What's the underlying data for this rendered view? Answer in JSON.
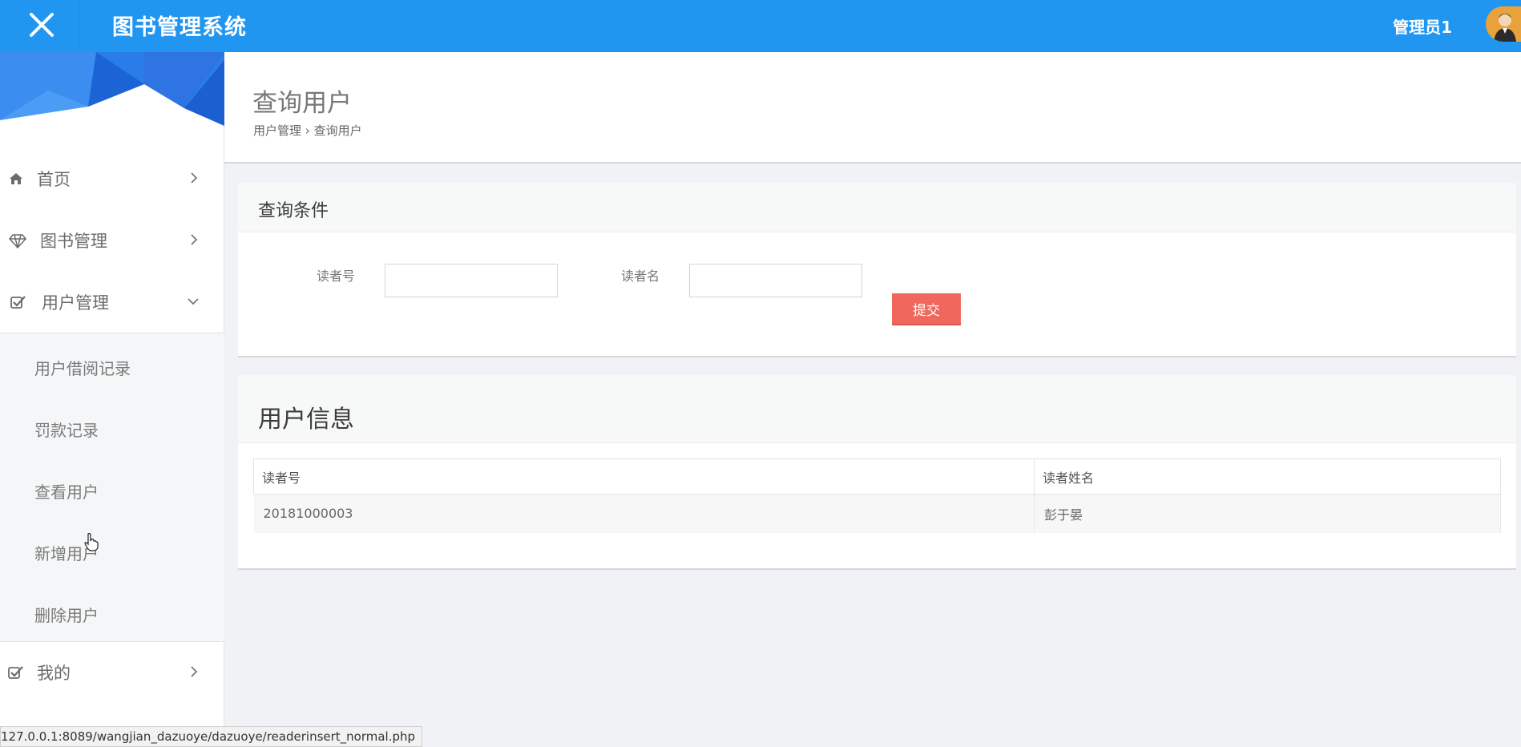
{
  "header": {
    "app_title": "图书管理系统",
    "user_name": "管理员1",
    "close_icon": "close-icon",
    "avatar_icon": "avatar"
  },
  "colors": {
    "topbar": "#2196f0",
    "submit_button": "#f0675b",
    "sidebar_banner": "#1f6fe0"
  },
  "sidebar": {
    "items": [
      {
        "label": "首页",
        "icon": "home-icon"
      },
      {
        "label": "图书管理",
        "icon": "diamond-icon"
      },
      {
        "label": "用户管理",
        "icon": "checkbox-icon",
        "expanded": true
      },
      {
        "label": "我的",
        "icon": "checkbox-icon"
      }
    ],
    "submenu": [
      {
        "label": "用户借阅记录"
      },
      {
        "label": "罚款记录"
      },
      {
        "label": "查看用户"
      },
      {
        "label": "新增用户"
      },
      {
        "label": "删除用户"
      }
    ]
  },
  "page": {
    "title": "查询用户",
    "breadcrumb": {
      "parent": "用户管理",
      "separator": "›",
      "current": "查询用户"
    }
  },
  "query_panel": {
    "title": "查询条件",
    "reader_id_label": "读者号",
    "reader_id_value": "",
    "reader_name_label": "读者名",
    "reader_name_value": "",
    "submit_label": "提交"
  },
  "results_panel": {
    "title": "用户信息",
    "columns": [
      "读者号",
      "读者姓名"
    ],
    "rows": [
      [
        "20181000003",
        "彭于晏"
      ]
    ]
  },
  "statusbar": {
    "url": "127.0.0.1:8089/wangjian_dazuoye/dazuoye/readerinsert_normal.php"
  }
}
